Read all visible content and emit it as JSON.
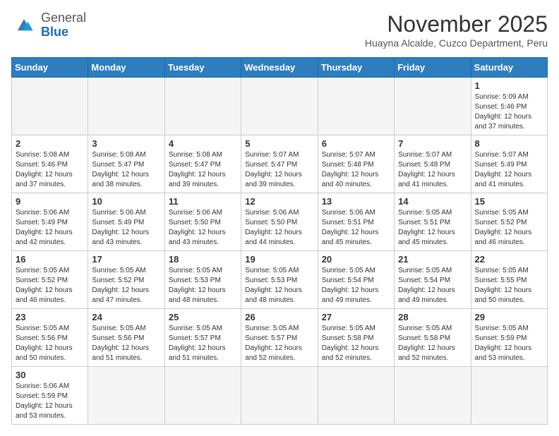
{
  "header": {
    "logo_general": "General",
    "logo_blue": "Blue",
    "month_title": "November 2025",
    "subtitle": "Huayna Alcalde, Cuzco Department, Peru"
  },
  "weekdays": [
    "Sunday",
    "Monday",
    "Tuesday",
    "Wednesday",
    "Thursday",
    "Friday",
    "Saturday"
  ],
  "weeks": [
    [
      {
        "day": "",
        "info": ""
      },
      {
        "day": "",
        "info": ""
      },
      {
        "day": "",
        "info": ""
      },
      {
        "day": "",
        "info": ""
      },
      {
        "day": "",
        "info": ""
      },
      {
        "day": "",
        "info": ""
      },
      {
        "day": "1",
        "info": "Sunrise: 5:09 AM\nSunset: 5:46 PM\nDaylight: 12 hours and 37 minutes."
      }
    ],
    [
      {
        "day": "2",
        "info": "Sunrise: 5:08 AM\nSunset: 5:46 PM\nDaylight: 12 hours and 37 minutes."
      },
      {
        "day": "3",
        "info": "Sunrise: 5:08 AM\nSunset: 5:47 PM\nDaylight: 12 hours and 38 minutes."
      },
      {
        "day": "4",
        "info": "Sunrise: 5:08 AM\nSunset: 5:47 PM\nDaylight: 12 hours and 39 minutes."
      },
      {
        "day": "5",
        "info": "Sunrise: 5:07 AM\nSunset: 5:47 PM\nDaylight: 12 hours and 39 minutes."
      },
      {
        "day": "6",
        "info": "Sunrise: 5:07 AM\nSunset: 5:48 PM\nDaylight: 12 hours and 40 minutes."
      },
      {
        "day": "7",
        "info": "Sunrise: 5:07 AM\nSunset: 5:48 PM\nDaylight: 12 hours and 41 minutes."
      },
      {
        "day": "8",
        "info": "Sunrise: 5:07 AM\nSunset: 5:49 PM\nDaylight: 12 hours and 41 minutes."
      }
    ],
    [
      {
        "day": "9",
        "info": "Sunrise: 5:06 AM\nSunset: 5:49 PM\nDaylight: 12 hours and 42 minutes."
      },
      {
        "day": "10",
        "info": "Sunrise: 5:06 AM\nSunset: 5:49 PM\nDaylight: 12 hours and 43 minutes."
      },
      {
        "day": "11",
        "info": "Sunrise: 5:06 AM\nSunset: 5:50 PM\nDaylight: 12 hours and 43 minutes."
      },
      {
        "day": "12",
        "info": "Sunrise: 5:06 AM\nSunset: 5:50 PM\nDaylight: 12 hours and 44 minutes."
      },
      {
        "day": "13",
        "info": "Sunrise: 5:06 AM\nSunset: 5:51 PM\nDaylight: 12 hours and 45 minutes."
      },
      {
        "day": "14",
        "info": "Sunrise: 5:05 AM\nSunset: 5:51 PM\nDaylight: 12 hours and 45 minutes."
      },
      {
        "day": "15",
        "info": "Sunrise: 5:05 AM\nSunset: 5:52 PM\nDaylight: 12 hours and 46 minutes."
      }
    ],
    [
      {
        "day": "16",
        "info": "Sunrise: 5:05 AM\nSunset: 5:52 PM\nDaylight: 12 hours and 46 minutes."
      },
      {
        "day": "17",
        "info": "Sunrise: 5:05 AM\nSunset: 5:52 PM\nDaylight: 12 hours and 47 minutes."
      },
      {
        "day": "18",
        "info": "Sunrise: 5:05 AM\nSunset: 5:53 PM\nDaylight: 12 hours and 48 minutes."
      },
      {
        "day": "19",
        "info": "Sunrise: 5:05 AM\nSunset: 5:53 PM\nDaylight: 12 hours and 48 minutes."
      },
      {
        "day": "20",
        "info": "Sunrise: 5:05 AM\nSunset: 5:54 PM\nDaylight: 12 hours and 49 minutes."
      },
      {
        "day": "21",
        "info": "Sunrise: 5:05 AM\nSunset: 5:54 PM\nDaylight: 12 hours and 49 minutes."
      },
      {
        "day": "22",
        "info": "Sunrise: 5:05 AM\nSunset: 5:55 PM\nDaylight: 12 hours and 50 minutes."
      }
    ],
    [
      {
        "day": "23",
        "info": "Sunrise: 5:05 AM\nSunset: 5:56 PM\nDaylight: 12 hours and 50 minutes."
      },
      {
        "day": "24",
        "info": "Sunrise: 5:05 AM\nSunset: 5:56 PM\nDaylight: 12 hours and 51 minutes."
      },
      {
        "day": "25",
        "info": "Sunrise: 5:05 AM\nSunset: 5:57 PM\nDaylight: 12 hours and 51 minutes."
      },
      {
        "day": "26",
        "info": "Sunrise: 5:05 AM\nSunset: 5:57 PM\nDaylight: 12 hours and 52 minutes."
      },
      {
        "day": "27",
        "info": "Sunrise: 5:05 AM\nSunset: 5:58 PM\nDaylight: 12 hours and 52 minutes."
      },
      {
        "day": "28",
        "info": "Sunrise: 5:05 AM\nSunset: 5:58 PM\nDaylight: 12 hours and 52 minutes."
      },
      {
        "day": "29",
        "info": "Sunrise: 5:05 AM\nSunset: 5:59 PM\nDaylight: 12 hours and 53 minutes."
      }
    ],
    [
      {
        "day": "30",
        "info": "Sunrise: 5:06 AM\nSunset: 5:59 PM\nDaylight: 12 hours and 53 minutes."
      },
      {
        "day": "",
        "info": ""
      },
      {
        "day": "",
        "info": ""
      },
      {
        "day": "",
        "info": ""
      },
      {
        "day": "",
        "info": ""
      },
      {
        "day": "",
        "info": ""
      },
      {
        "day": "",
        "info": ""
      }
    ]
  ]
}
